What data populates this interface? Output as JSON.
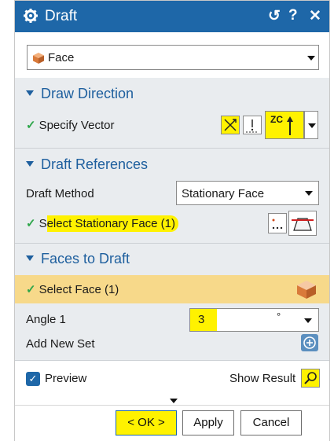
{
  "title": "Draft",
  "titlebar": {
    "reset": "↺",
    "help": "?",
    "close": "✕"
  },
  "type_select": {
    "value": "Face"
  },
  "draw_direction": {
    "heading": "Draw Direction",
    "specify_vector": "Specify Vector",
    "vector_icon_text": "ZC"
  },
  "draft_references": {
    "heading": "Draft References",
    "draft_method_label": "Draft Method",
    "draft_method_value": "Stationary Face",
    "select_stationary_prefix": "S",
    "select_stationary_rest": "elect Stationary Face (1)"
  },
  "faces_to_draft": {
    "heading": "Faces to Draft",
    "select_face": "Select Face (1)",
    "angle_label": "Angle 1",
    "angle_value": "3",
    "angle_unit": "°",
    "add_new_set": "Add New Set"
  },
  "footer": {
    "preview_label": "Preview",
    "show_result_label": "Show Result",
    "ok_label": "< OK >",
    "apply_label": "Apply",
    "cancel_label": "Cancel"
  },
  "colors": {
    "title_bar": "#1e67a8",
    "section_text": "#1e5f9e",
    "highlight": "#fff200",
    "select_row": "#f7d98a",
    "check": "#2ea64a"
  },
  "icons": [
    "gear-icon",
    "reset-icon",
    "help-icon",
    "close-icon",
    "face-cube-icon",
    "vector-dialog-icon",
    "infer-vector-icon",
    "zc-axis-icon",
    "point-dots-icon",
    "stationary-face-icon",
    "face-select-icon",
    "add-set-icon",
    "magnifier-icon"
  ]
}
